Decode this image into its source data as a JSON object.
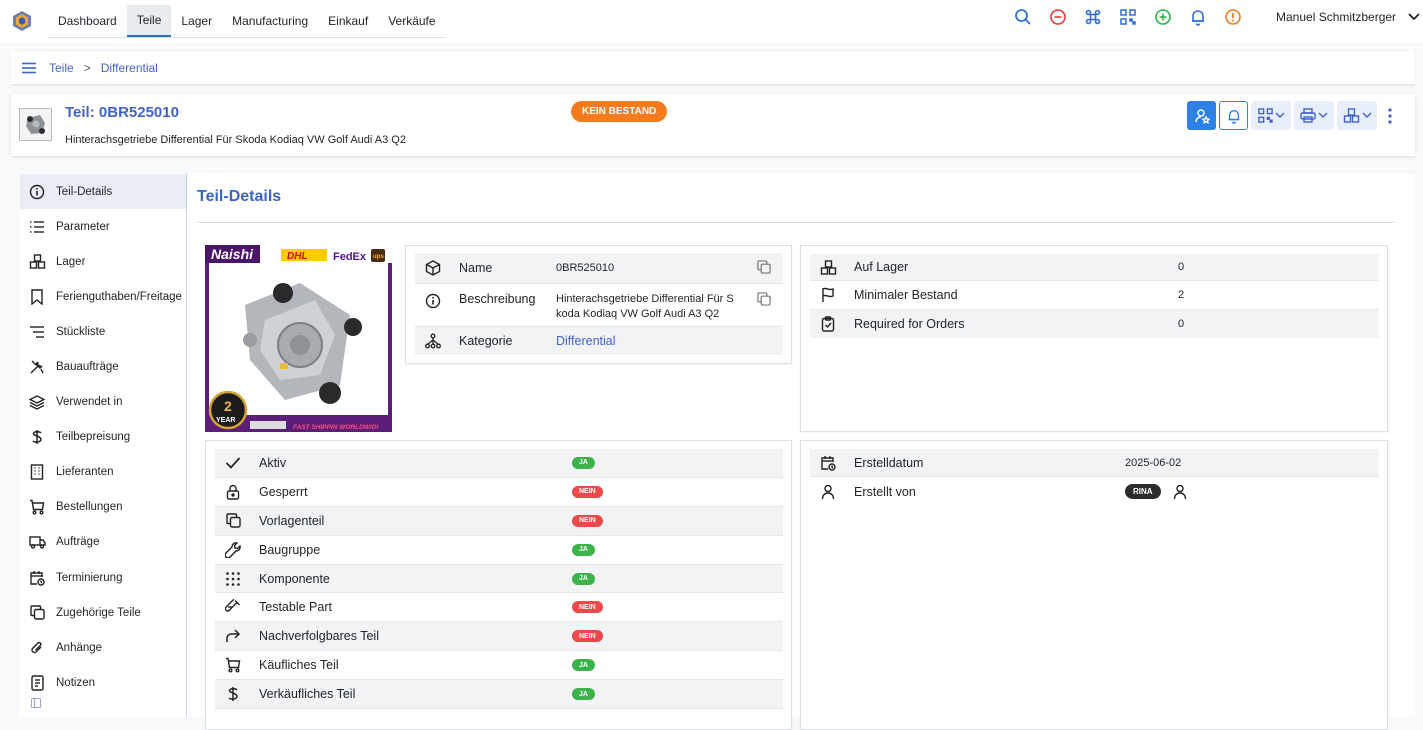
{
  "nav": {
    "tabs": [
      "Dashboard",
      "Teile",
      "Lager",
      "Manufacturing",
      "Einkauf",
      "Verkäufe"
    ],
    "active_tab": "Teile",
    "user_name": "Manuel Schmitzberger"
  },
  "breadcrumb": [
    "Teile",
    "Differential"
  ],
  "part": {
    "title": "Teil: 0BR525010",
    "subtitle": "Hinterachsgetriebe Differential Für Skoda Kodiaq VW Golf Audi A3 Q2",
    "stock_badge": "KEIN BESTAND"
  },
  "sidebar": {
    "items": [
      {
        "label": "Teil-Details",
        "icon": "info-icon"
      },
      {
        "label": "Parameter",
        "icon": "list-icon"
      },
      {
        "label": "Lager",
        "icon": "boxes-icon"
      },
      {
        "label": "Feriengutha­ben/Freitage",
        "icon": "bookmark-icon"
      },
      {
        "label": "Stückliste",
        "icon": "list-tree-icon"
      },
      {
        "label": "Bauaufträge",
        "icon": "tools-icon"
      },
      {
        "label": "Verwendet in",
        "icon": "stack-icon"
      },
      {
        "label": "Teilbepreisung",
        "icon": "dollar-icon"
      },
      {
        "label": "Lieferanten",
        "icon": "building-icon"
      },
      {
        "label": "Bestellungen",
        "icon": "cart-icon"
      },
      {
        "label": "Aufträge",
        "icon": "truck-icon"
      },
      {
        "label": "Terminierung",
        "icon": "calendar-clock-icon"
      },
      {
        "label": "Zugehörige Teile",
        "icon": "copy-icon"
      },
      {
        "label": "Anhänge",
        "icon": "paperclip-icon"
      },
      {
        "label": "Notizen",
        "icon": "note-icon"
      }
    ]
  },
  "main": {
    "title": "Teil-Details",
    "image_text": {
      "brand": "Naishi",
      "dhl": "DHL",
      "fedex": "FedEx",
      "ups": "ups",
      "warranty_num": "2",
      "warranty_word": "YEAR",
      "footer": "FAST SHIPPIN WORLDWID!"
    },
    "details": [
      {
        "label": "Name",
        "value": "0BR525010",
        "icon": "box-icon"
      },
      {
        "label": "Beschreibung",
        "value": "Hinterachsgetriebe Differential Für S koda Kodiaq VW Golf Audi A3 Q2",
        "icon": "info-icon"
      },
      {
        "label": "Kategorie",
        "value": "Differential",
        "icon": "sitemap-icon"
      }
    ],
    "stock": [
      {
        "label": "Auf Lager",
        "value": "0",
        "icon": "boxes-icon"
      },
      {
        "label": "Minimaler Bestand",
        "value": "2",
        "icon": "flag-icon"
      },
      {
        "label": "Required for Orders",
        "value": "0",
        "icon": "clipboard-check-icon"
      }
    ],
    "flags": [
      {
        "label": "Aktiv",
        "value": "JA",
        "icon": "check-icon"
      },
      {
        "label": "Gesperrt",
        "value": "NEIN",
        "icon": "lock-icon"
      },
      {
        "label": "Vorlagenteil",
        "value": "NEIN",
        "icon": "copy-icon"
      },
      {
        "label": "Baugruppe",
        "value": "JA",
        "icon": "wrench-icon"
      },
      {
        "label": "Komponente",
        "value": "JA",
        "icon": "grid-dots-icon"
      },
      {
        "label": "Testable Part",
        "value": "NEIN",
        "icon": "test-pipe-icon"
      },
      {
        "label": "Nachverfolgbares Teil",
        "value": "NEIN",
        "icon": "arrow-forward-icon"
      },
      {
        "label": "Käufliches Teil",
        "value": "JA",
        "icon": "cart-icon"
      },
      {
        "label": "Verkäufliches Teil",
        "value": "JA",
        "icon": "dollar-icon"
      }
    ],
    "meta": [
      {
        "label": "Erstelldatum",
        "value": "2025-06-02",
        "icon": "calendar-clock-icon"
      },
      {
        "label": "Erstellt von",
        "value": "RINA",
        "icon": "user-icon"
      }
    ]
  },
  "colors": {
    "accent": "#3f63c9",
    "badge_orange": "#f47c1f",
    "ja_green": "#3cb34a",
    "nein_red": "#ea4a4a",
    "primary_btn": "#2f80e4"
  }
}
